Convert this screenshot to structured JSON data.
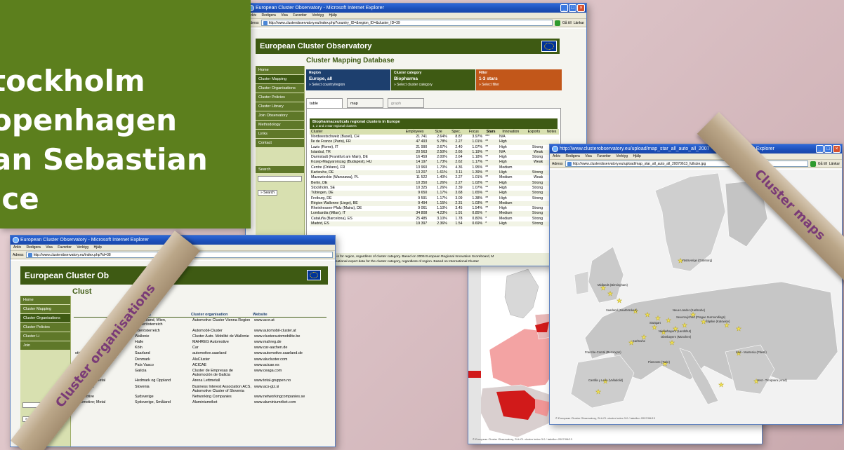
{
  "banner": {
    "cities": [
      "tockholm",
      "openhagen",
      "an Sebastian",
      "ice"
    ]
  },
  "win_main": {
    "title": "European Cluster Observatory - Microsoft Internet Explorer",
    "menu": [
      "Arkiv",
      "Redigera",
      "Visa",
      "Favoriter",
      "Verktyg",
      "Hjälp"
    ],
    "address_label": "Adress",
    "url": "http://www.clusterobservatory.eu/index.php?country_ID=&region_ID=&cluster_ID=39",
    "go_label": "Gå till",
    "links_label": "Länkar",
    "site_title": "European Cluster Observatory",
    "page_heading": "Cluster Mapping Database",
    "nav": [
      "Home",
      "Cluster Mapping",
      "Cluster Organisations",
      "Cluster Policies",
      "Cluster Library",
      "Join Observatory",
      "Methodology",
      "Links",
      "Contact"
    ],
    "search_label": "Search",
    "search_button": "» Search",
    "filters": {
      "region_label": "Region",
      "region_value": "Europe, all",
      "region_link": "» Select country/region",
      "category_label": "Cluster category",
      "category_value": "Biopharma",
      "category_link": "» Select cluster category",
      "filter_label": "Filter",
      "filter_value": "1-3 stars",
      "filter_link": "» Select filter"
    },
    "tabs": [
      "table",
      "map",
      "graph"
    ],
    "table_title": "Biopharmaceuticals regional clusters in Europe",
    "table_subtitle": "1, 2 and 3 star regional clusters",
    "columns": [
      "Cluster",
      "Employees",
      "Size",
      "Spec.",
      "Focus",
      "Stars",
      "Innovation",
      "Exports",
      "Notes"
    ],
    "rows": [
      [
        "Nordwestschweiz (Basel), CH",
        "21 741",
        "2.64%",
        "8.87",
        "3.97%",
        "***",
        "N/A",
        ""
      ],
      [
        "Île de France (Paris), FR",
        "47 493",
        "5.78%",
        "2.27",
        "1.01%",
        "**",
        "High",
        ""
      ],
      [
        "Lazio (Rome), IT",
        "21 990",
        "2.67%",
        "2.40",
        "1.07%",
        "**",
        "High",
        "Strong"
      ],
      [
        "Istanbul, TR",
        "20 563",
        "2.50%",
        "2.66",
        "1.19%",
        "**",
        "N/A",
        "Weak"
      ],
      [
        "Darmstadt (Frankfurt am Main), DE",
        "16 459",
        "2.00%",
        "2.64",
        "1.18%",
        "**",
        "High",
        "Strong"
      ],
      [
        "Kozep-Magyarorszag (Budapest), HU",
        "14 197",
        "1.73%",
        "2.62",
        "1.17%",
        "**",
        "High",
        "Weak"
      ],
      [
        "Centre (Orléans), FR",
        "13 960",
        "1.70%",
        "4.36",
        "1.95%",
        "**",
        "Medium",
        ""
      ],
      [
        "Karlsruhe, DE",
        "13 207",
        "1.61%",
        "3.11",
        "1.39%",
        "**",
        "High",
        "Strong"
      ],
      [
        "Mazowieckie (Warszawa), PL",
        "11 522",
        "1.40%",
        "2.27",
        "1.01%",
        "**",
        "Medium",
        "Weak"
      ],
      [
        "Berlin, DE",
        "10 350",
        "1.26%",
        "2.27",
        "1.02%",
        "**",
        "High",
        "Strong"
      ],
      [
        "Stockholm, SE",
        "10 325",
        "1.26%",
        "2.39",
        "1.07%",
        "**",
        "High",
        "Strong"
      ],
      [
        "Tübingen, DE",
        "9 650",
        "1.17%",
        "3.68",
        "1.65%",
        "**",
        "High",
        "Strong"
      ],
      [
        "Freiburg, DE",
        "9 591",
        "1.17%",
        "3.09",
        "1.38%",
        "**",
        "High",
        "Strong"
      ],
      [
        "Région Wallonne (Liege), BE",
        "9 494",
        "1.15%",
        "2.31",
        "1.03%",
        "**",
        "Medium",
        ""
      ],
      [
        "Rheinhessen-Pfalz (Mainz), DE",
        "9 061",
        "1.10%",
        "3.45",
        "1.54%",
        "**",
        "High",
        "Strong"
      ],
      [
        "Lombardia (Milan), IT",
        "34 808",
        "4.23%",
        "1.91",
        "0.85%",
        "*",
        "Medium",
        "Strong"
      ],
      [
        "Cataluña (Barcelona), ES",
        "25 485",
        "3.10%",
        "1.78",
        "0.80%",
        "*",
        "Medium",
        "Strong"
      ],
      [
        "Madrid, ES",
        "19 397",
        "2.36%",
        "1.54",
        "0.69%",
        "*",
        "High",
        "Strong"
      ]
    ],
    "footnote_1_label": "Innovation",
    "footnote_1": ": Data is for region, regardless of cluster category. Based on 2006 European Regional Innovation Scoreboard, M",
    "footnote_2_label": "Exports",
    "footnote_2": ": Data is national export data for the cluster category, regardless of region. Based on International Cluster"
  },
  "win_orgs": {
    "title": "European Cluster Observatory - Microsoft Internet Explorer",
    "menu": [
      "Arkiv",
      "Redigera",
      "Visa",
      "Favoriter",
      "Verktyg",
      "Hjälp"
    ],
    "address_label": "Adress",
    "url": "http://www.clusterobservatory.eu/index.php?id=38",
    "site_title": "European Cluster Ob",
    "heading": "Clust",
    "nav": [
      "Home",
      "Cluster Mapping",
      "Cluster Organisations",
      "Cluster Policies",
      "Cluster Li",
      "Join"
    ],
    "search_button": "» Search",
    "columns": [
      "Region(s)",
      "Cluster organisation",
      "Website"
    ],
    "rows": [
      [
        "",
        "Burgenland, Wien, Niederösterreich",
        "Automotive Cluster Vienna Region",
        "www.acvr.at"
      ],
      [
        "",
        "Oberösterreich",
        "Automobil-Cluster",
        "www.automobil-cluster.at"
      ],
      [
        "",
        "Wallonie",
        "Cluster Auto- Mobilité de Wallonie",
        "www.clusterautomobilite.be"
      ],
      [
        "",
        "Halle",
        "MAHREG Automotive",
        "www.mahreg.de"
      ],
      [
        "",
        "Köln",
        "Car",
        "www.car-aachen.de"
      ],
      [
        "otive",
        "Saarland",
        "automotive.saarland",
        "www.automotive.saarland.de"
      ],
      [
        "utomotive; Metal",
        "Denmark",
        "AluCluster",
        "www.alucluster.com"
      ],
      [
        "Automotive",
        "País Vasco",
        "ACICAE",
        "www.acicae.es"
      ],
      [
        "Automotive",
        "Galicia",
        "Cluster de Empresas de Automoción de Galicia",
        "www.ceaga.com"
      ],
      [
        "Automotive; Metal",
        "Hedmark og Oppland",
        "Arena Lettmetall",
        "www.total-gruppen.no"
      ],
      [
        "Automotive",
        "Slovenia",
        "Business Interest Association ACS, Automotive Cluster of Slovenia",
        "www.acs-giz.si"
      ],
      [
        "Automotive",
        "Sydsverige",
        "Networking Companies",
        "www.networkingcompanies.se"
      ],
      [
        "Automotive; Metal",
        "Sydsverige, Småland",
        "Aluminiumriket",
        "www.aluminiumriket.com"
      ]
    ]
  },
  "win_map": {
    "title": "http://www.clusterobservatory.eu/upload/map_star_all_auto_all_2007",
    "title_suffix": "- Microsoft Internet Explorer",
    "menu": [
      "Arkiv",
      "Redigera",
      "Visa",
      "Favoriter",
      "Verktyg",
      "Hjälp"
    ],
    "address_label": "Adress",
    "url": "http://www.clusterobservatory.eu/upload/map_star_all_auto_all_20070613_fullsize.jpg",
    "go_label": "Gå till",
    "links_label": "Länkar",
    "labels": [
      "Västsverige (Göteborg)",
      "Midlands (Birmingham)",
      "Neue Länder (Karlsruhe)",
      "Saarland (Saarbrücken)",
      "Severovýchod (Prague Surroundings)",
      "Stuttgart",
      "Niederbayern (Landshut)",
      "Oberbayern (München)",
      "Karlsruhe",
      "Franche-Comté (Besançon)",
      "Piemonte (Turin)",
      "Śląskie (Katowice)",
      "Castilla y León (Valladolid)",
      "Sud - Muntenia (Pitesti)",
      "Vest - Timişoara (Arad)"
    ],
    "footer": "© European Cluster Observatory, SLL/Cl. cluster index 3.0 / tabellen 2007/06/13"
  },
  "win_red_map": {
    "footer": "© European Cluster Observatory, SLL/Cl. cluster index 3.0 / tabellen 2007/06/13"
  },
  "ribbons": {
    "left": "Cluster organisations",
    "right": "Cluster maps"
  }
}
